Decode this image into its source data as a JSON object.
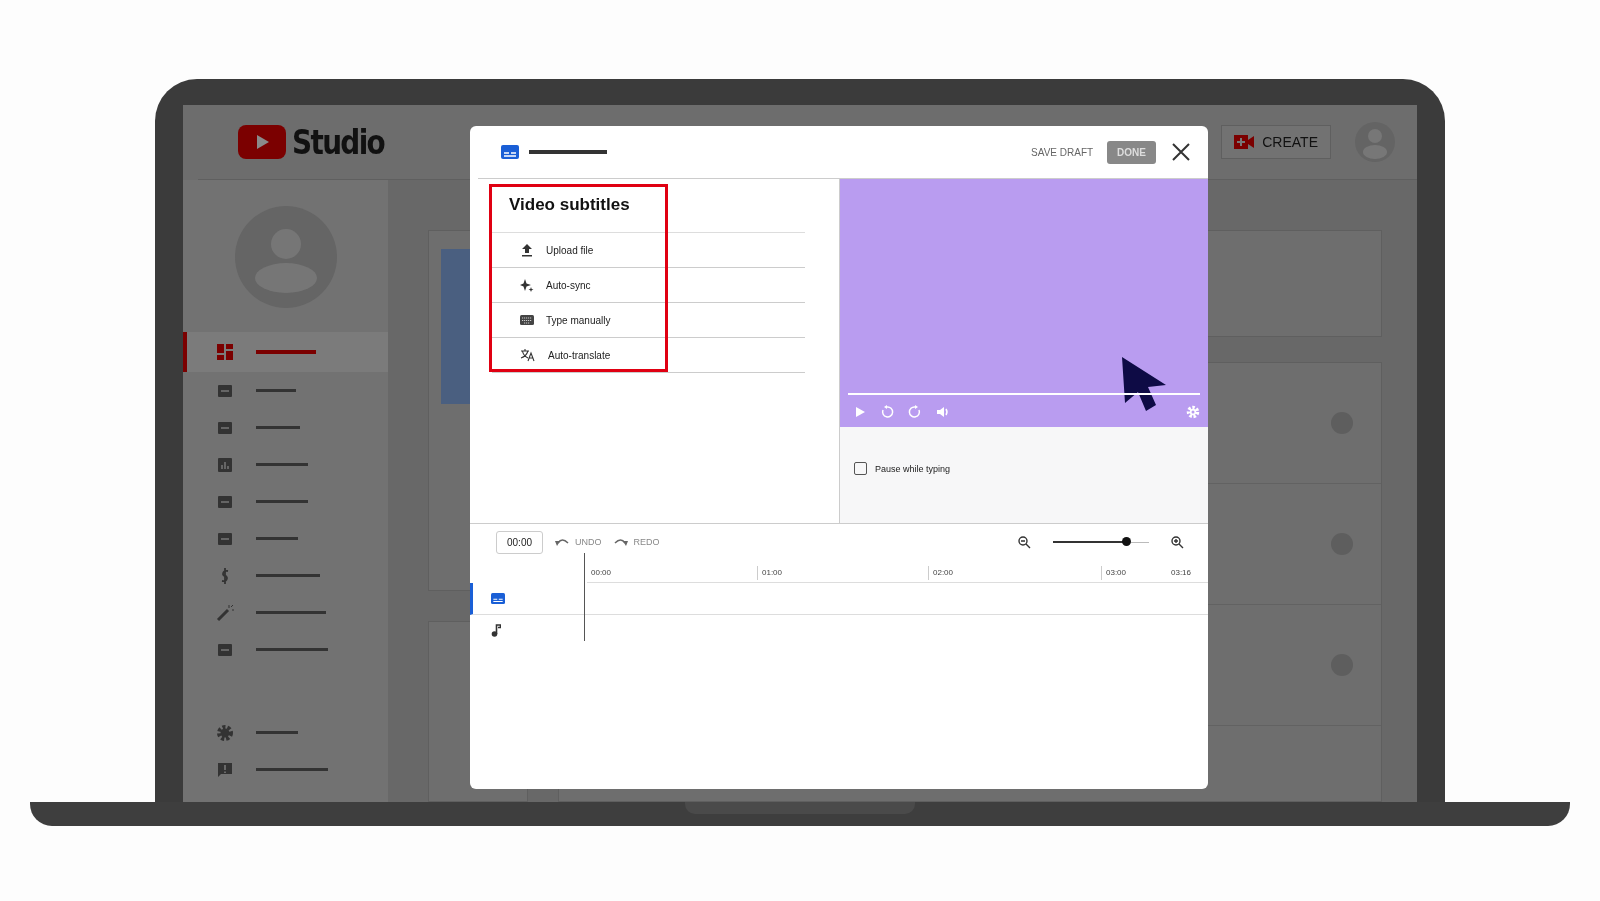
{
  "app": {
    "logo_text": "Studio",
    "create_button": "CREATE",
    "nav": [
      {
        "selected": true
      },
      {
        "selected": false
      },
      {
        "selected": false
      },
      {
        "selected": false
      },
      {
        "selected": false
      },
      {
        "selected": false
      },
      {
        "selected": false
      },
      {
        "selected": false
      },
      {
        "selected": false
      }
    ],
    "bottom_nav": [
      {
        "selected": false
      },
      {
        "selected": false
      }
    ]
  },
  "dialog": {
    "save_draft": "SAVE DRAFT",
    "done": "DONE",
    "menu": {
      "title": "Video subtitles",
      "highlighted": true,
      "options": [
        {
          "kind": "upload",
          "label": "Upload file"
        },
        {
          "kind": "sync",
          "label": "Auto-sync"
        },
        {
          "kind": "type",
          "label": "Type manually"
        },
        {
          "kind": "translate",
          "label": "Auto-translate"
        }
      ]
    },
    "pause_while_typing": {
      "label": "Pause while typing",
      "checked": false
    },
    "timeline": {
      "time": "00:00",
      "undo": "UNDO",
      "redo": "REDO",
      "zoom": {
        "level": 0.76
      },
      "ticks": [
        "00:00",
        "01:00",
        "02:00",
        "03:00",
        "03:16"
      ],
      "tracks": [
        {
          "kind": "subtitles",
          "selected": true
        },
        {
          "kind": "audio",
          "selected": false
        }
      ]
    }
  }
}
